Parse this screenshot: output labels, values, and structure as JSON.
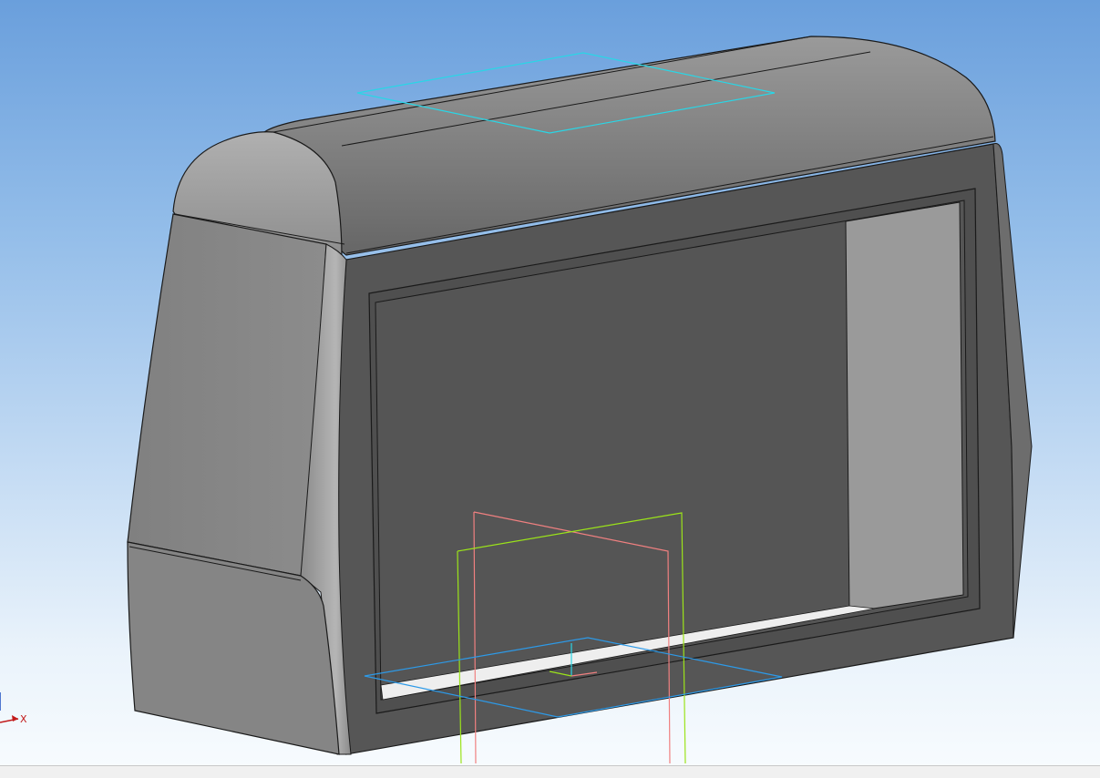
{
  "viewport": {
    "triad": {
      "x_label": "X"
    },
    "planes": {
      "top": "#29d6e6",
      "front": "#f08080",
      "right": "#9be31a",
      "bottom": "#2d9ae8"
    },
    "colors": {
      "body": "#5a5a5a",
      "edge": "#1a1a1a",
      "side_face": "#878787",
      "inner_wall": "#9a9a9a"
    }
  }
}
